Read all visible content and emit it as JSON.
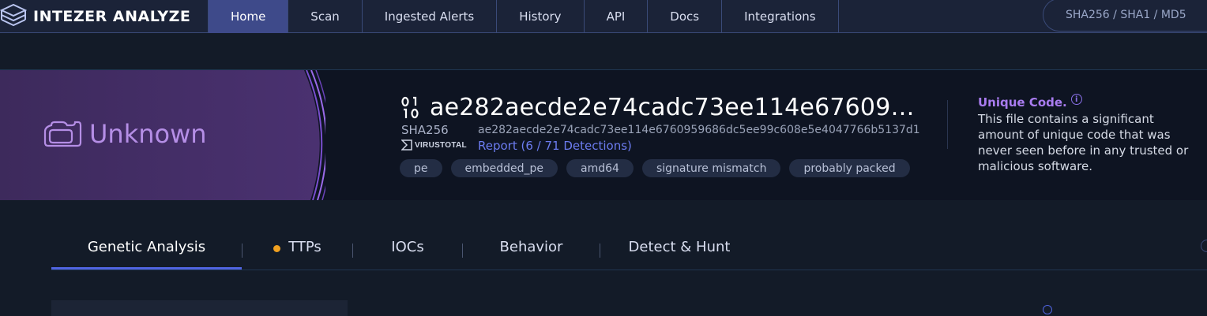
{
  "app": {
    "brand": "INTEZER ANALYZE"
  },
  "nav": {
    "tabs": [
      {
        "label": "Home",
        "active": true
      },
      {
        "label": "Scan"
      },
      {
        "label": "Ingested Alerts"
      },
      {
        "label": "History"
      },
      {
        "label": "API"
      },
      {
        "label": "Docs"
      },
      {
        "label": "Integrations"
      }
    ],
    "search_placeholder": "SHA256 / SHA1 / MD5"
  },
  "verdict": {
    "label": "Unknown",
    "icon": "cloud-file-icon"
  },
  "file": {
    "title": "ae282aecde2e74cadc73ee114e67609…",
    "hash_label": "SHA256",
    "hash_value": "ae282aecde2e74cadc73ee114e6760959686dc5ee99c608e5e4047766b5137d1",
    "vt_label": "VIRUSTOTAL",
    "report_link": "Report (6 / 71 Detections)",
    "tags": [
      "pe",
      "embedded_pe",
      "amd64",
      "signature mismatch",
      "probably packed"
    ]
  },
  "unique_code": {
    "title": "Unique Code.",
    "info": "i",
    "description": "This file contains a significant amount of unique code that was never seen before in any trusted or malicious software."
  },
  "analysis_tabs": [
    {
      "label": "Genetic Analysis",
      "active": true
    },
    {
      "label": "TTPs",
      "indicator": true
    },
    {
      "label": "IOCs"
    },
    {
      "label": "Behavior"
    },
    {
      "label": "Detect & Hunt"
    }
  ],
  "colors": {
    "accent": "#5064e0",
    "verdict": "#b58ee6",
    "indicator": "#f0a020"
  }
}
